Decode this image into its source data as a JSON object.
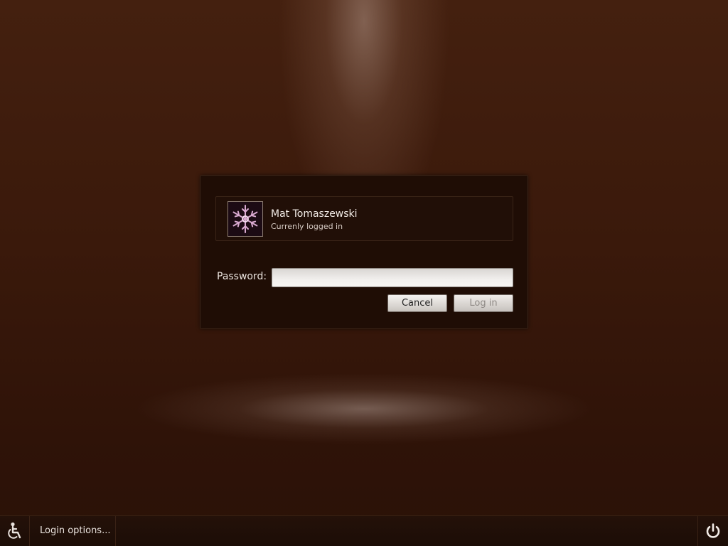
{
  "user": {
    "name": "Mat Tomaszewski",
    "status": "Currenly logged in",
    "avatar_icon": "snowflake-icon"
  },
  "login_form": {
    "password_label": "Password:",
    "password_value": "",
    "cancel_label": "Cancel",
    "login_label": "Log in",
    "login_enabled": false
  },
  "bottom_bar": {
    "accessibility_icon": "accessibility-icon",
    "login_options_label": "Login options...",
    "power_icon": "power-icon"
  },
  "colors": {
    "background": "#3d1a0b",
    "dialog": "#1f0d05",
    "text": "#f3ece7"
  }
}
